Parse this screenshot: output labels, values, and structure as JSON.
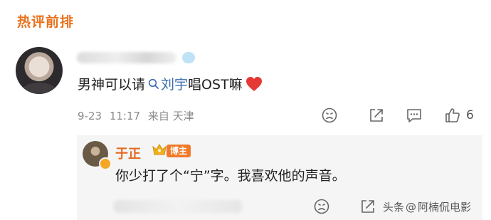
{
  "section_title": "热评前排",
  "comment": {
    "text_before": "男神可以请",
    "link_text": "刘宇",
    "text_after": "唱OST嘛",
    "date": "9-23",
    "time": "11:17",
    "location": "来自 天津",
    "like_count": "6"
  },
  "reply": {
    "name": "于正",
    "badge": "博主",
    "text": "你少打了个“宁”字。我喜欢他的声音。"
  },
  "watermark": {
    "prefix": "头条",
    "at": "@",
    "account": "阿楠侃电影"
  },
  "icons": {
    "search": "search-icon",
    "heart": "heart-icon",
    "dislike": "dislike-face-icon",
    "share": "share-icon",
    "comment": "comment-icon",
    "like": "thumbs-up-icon",
    "crown": "crown-icon"
  },
  "colors": {
    "title_orange": "#e8721e",
    "link_blue": "#3a6cb0",
    "heart_red": "#e53935",
    "badge_orange": "#f07a2a",
    "reply_bg": "#f5f5f5"
  }
}
